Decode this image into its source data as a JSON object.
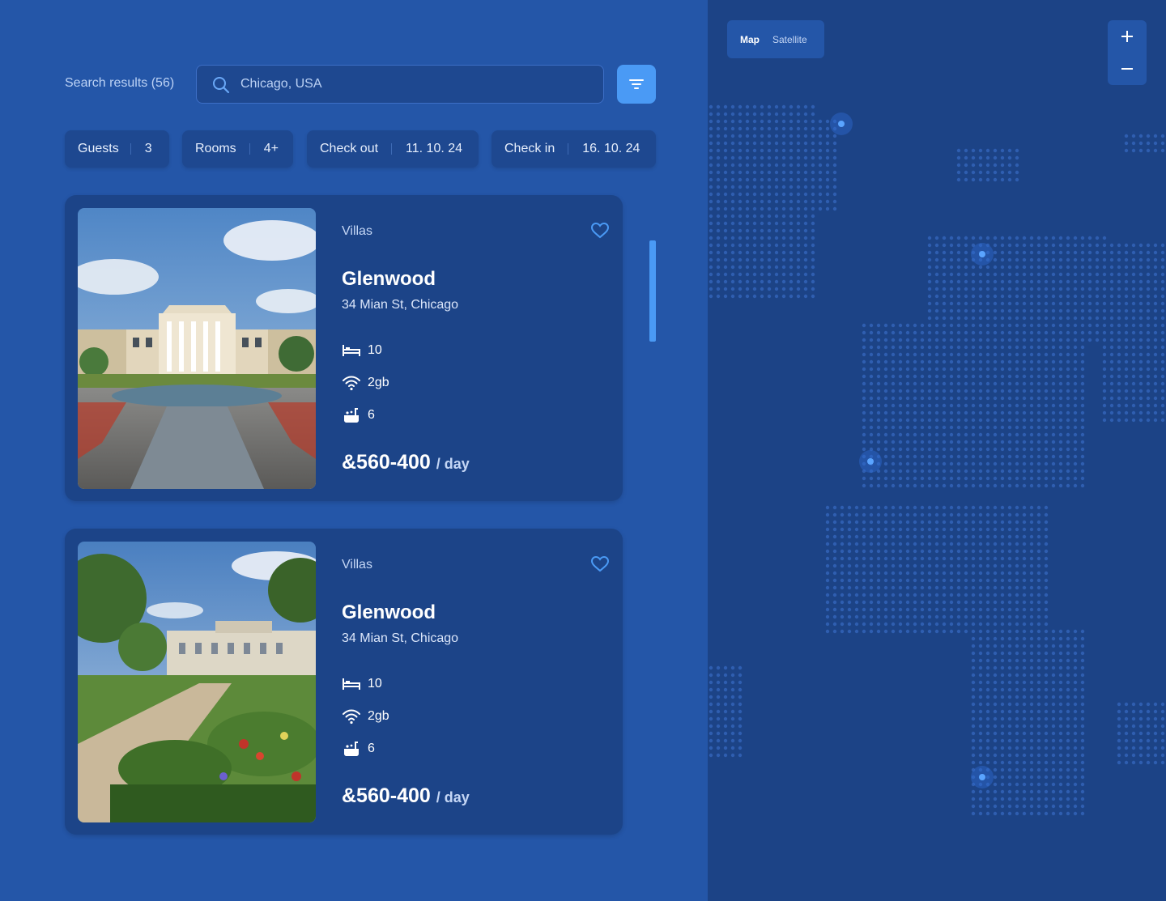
{
  "search": {
    "results_label": "Search results (56)",
    "query": "Chicago, USA"
  },
  "filters": [
    {
      "label": "Guests",
      "value": "3"
    },
    {
      "label": "Rooms",
      "value": "4+"
    },
    {
      "label": "Check out",
      "value": "11. 10. 24"
    },
    {
      "label": "Check in",
      "value": "16. 10. 24"
    }
  ],
  "listings": [
    {
      "category": "Villas",
      "name": "Glenwood",
      "address": "34 Mian St, Chicago",
      "beds": "10",
      "wifi": "2gb",
      "baths": "6",
      "price": "&560-400",
      "per": "/ day"
    },
    {
      "category": "Villas",
      "name": "Glenwood",
      "address": "34 Mian St, Chicago",
      "beds": "10",
      "wifi": "2gb",
      "baths": "6",
      "price": "&560-400",
      "per": "/ day"
    }
  ],
  "map": {
    "mode_map": "Map",
    "mode_satellite": "Satellite",
    "zoom_in": "+",
    "zoom_out": "−"
  },
  "colors": {
    "background": "#2456a8",
    "card": "#1c4488",
    "accent": "#4a9af5",
    "map_background": "#1c4386"
  },
  "icons": [
    "search-icon",
    "filter-icon",
    "heart-icon",
    "bed-icon",
    "wifi-icon",
    "bathtub-icon",
    "zoom-in-icon",
    "zoom-out-icon"
  ]
}
